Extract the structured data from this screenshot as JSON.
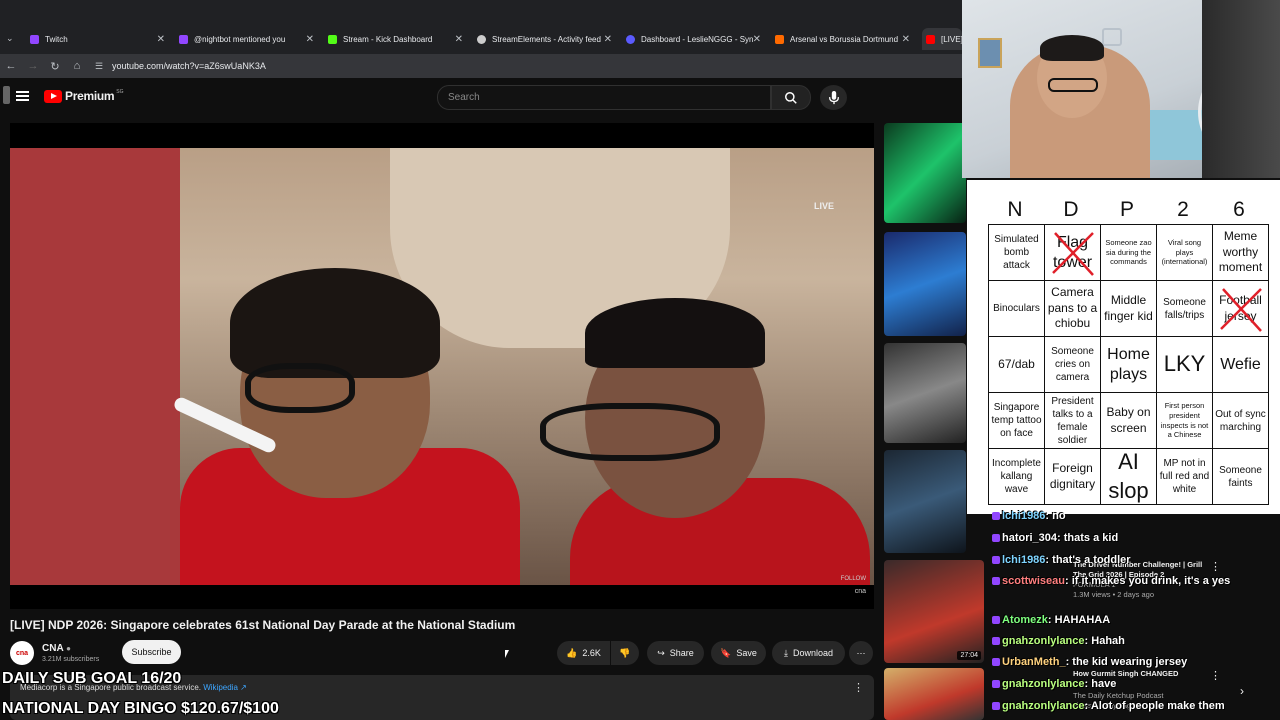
{
  "browser": {
    "tabs": [
      {
        "label": "Twitch",
        "color": "#9146ff"
      },
      {
        "label": "@nightbot mentioned you",
        "color": "#9146ff"
      },
      {
        "label": "Stream - Kick Dashboard",
        "color": "#53fc18"
      },
      {
        "label": "StreamElements - Activity feed",
        "color": "#cccccc"
      },
      {
        "label": "Dashboard - LeslieNGGG - Syn",
        "color": "#5b5bff"
      },
      {
        "label": "Arsenal vs Borussia Dortmund",
        "color": "#ff6a00"
      },
      {
        "label": "[LIVE] N",
        "color": "#ff0000"
      }
    ],
    "url": "youtube.com/watch?v=aZ6swUaNK3A"
  },
  "youtube": {
    "logo": "Premium",
    "logo_sup": "SG",
    "search_placeholder": "Search",
    "video_title": "[LIVE] NDP 2026: Singapore celebrates 61st National Day Parade at the National Stadium",
    "live_bug": "LIVE",
    "follow_text": "FOLLOW",
    "follow_sub": "cna",
    "channel": {
      "name": "CNA",
      "avatar_text": "cna",
      "subscribers": "3.21M subscribers"
    },
    "subscribe_label": "Subscribe",
    "likes": "2.6K",
    "share_label": "Share",
    "save_label": "Save",
    "download_label": "Download",
    "description": "Mediacorp is a Singapore public broadcast service.",
    "description_link": "Wikipedia ↗"
  },
  "overlays": {
    "sub_goal": "DAILY SUB GOAL 16/20",
    "bingo_goal": "NATIONAL DAY BINGO $120.67/$100"
  },
  "recommendations": [
    {
      "title": "The Driver Number Challenge! | Grill The Grid 2026 | Episode 2",
      "channel": "FORMULA 1",
      "meta": "1.3M views • 2 days ago",
      "duration": "27:04"
    },
    {
      "title": "How Gurmit Singh CHANGED",
      "channel": "The Daily Ketchup Podcast",
      "meta": "views • 2 days ago",
      "duration": ""
    }
  ],
  "bingo": {
    "header": [
      "N",
      "D",
      "P",
      "2",
      "6"
    ],
    "cells": [
      {
        "text": "Simulated bomb attack",
        "size": "",
        "crossed": false
      },
      {
        "text": "Flag tower",
        "size": "big",
        "crossed": true
      },
      {
        "text": "Someone zao sia during the commands",
        "size": "small",
        "crossed": false
      },
      {
        "text": "Viral song plays (international)",
        "size": "small",
        "crossed": false
      },
      {
        "text": "Meme worthy moment",
        "size": "md",
        "crossed": false
      },
      {
        "text": "Binoculars",
        "size": "",
        "crossed": false
      },
      {
        "text": "Camera pans to a chiobu",
        "size": "md",
        "crossed": false
      },
      {
        "text": "Middle finger kid",
        "size": "md",
        "crossed": false
      },
      {
        "text": "Someone falls/trips",
        "size": "",
        "crossed": false
      },
      {
        "text": "Football jersey",
        "size": "md",
        "crossed": true
      },
      {
        "text": "67/dab",
        "size": "md",
        "crossed": false
      },
      {
        "text": "Someone cries on camera",
        "size": "",
        "crossed": false
      },
      {
        "text": "Home plays",
        "size": "big",
        "crossed": false
      },
      {
        "text": "LKY",
        "size": "huge",
        "crossed": false
      },
      {
        "text": "Wefie",
        "size": "big",
        "crossed": false
      },
      {
        "text": "Singapore temp tattoo on face",
        "size": "",
        "crossed": false
      },
      {
        "text": "President talks to a female soldier",
        "size": "",
        "crossed": false
      },
      {
        "text": "Baby on screen",
        "size": "md",
        "crossed": false
      },
      {
        "text": "First person president inspects is not a Chinese",
        "size": "small",
        "crossed": false
      },
      {
        "text": "Out of sync marching",
        "size": "",
        "crossed": false
      },
      {
        "text": "Incomplete kallang wave",
        "size": "",
        "crossed": false
      },
      {
        "text": "Foreign dignitary",
        "size": "md",
        "crossed": false
      },
      {
        "text": "AI slop",
        "size": "huge",
        "crossed": false
      },
      {
        "text": "MP not in full red and white",
        "size": "",
        "crossed": false
      },
      {
        "text": "Someone faints",
        "size": "",
        "crossed": false
      }
    ]
  },
  "chat": [
    {
      "user": "lchi1986",
      "msg": "no",
      "color": "#7fd4ff"
    },
    {
      "user": "hatori_304",
      "msg": "thats a kid",
      "color": "#ffffff"
    },
    {
      "user": "lchi1986",
      "msg": "that's a toddler",
      "color": "#7fd4ff"
    },
    {
      "user": "scottwiseau",
      "msg": "if it makes you drink, it's a yes",
      "color": "#ff7f7f"
    },
    {
      "user": "Atomezk",
      "msg": "HAHAHAA",
      "color": "#7fff7f"
    },
    {
      "user": "gnahzonlylance",
      "msg": "Hahah",
      "color": "#b9ff7f"
    },
    {
      "user": "UrbanMeth_",
      "msg": "the kid wearing jersey",
      "color": "#ffd27f"
    },
    {
      "user": "gnahzonlylance",
      "msg": "have",
      "color": "#b9ff7f"
    },
    {
      "user": "gnahzonlylance",
      "msg": "Alot of people make them",
      "color": "#b9ff7f"
    }
  ]
}
